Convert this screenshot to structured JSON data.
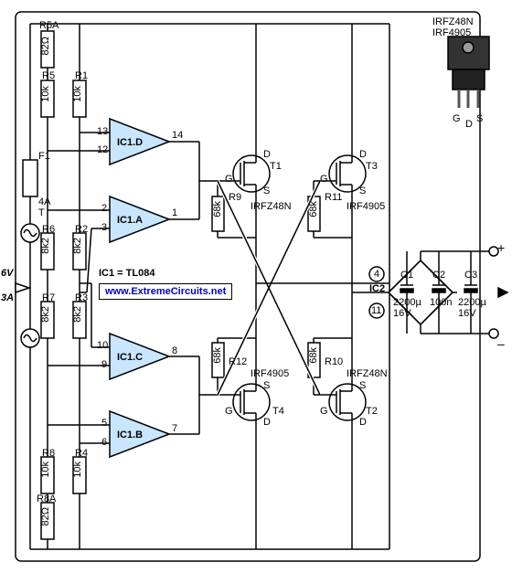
{
  "mosfets_list": "IRFZ48N\nIRF4905",
  "package_pins": {
    "g": "G",
    "d": "D",
    "s": "S"
  },
  "ic_note": "IC1  = TL084",
  "url": "www.ExtremeCircuits.net",
  "supply": {
    "v": "6V",
    "a": "3A"
  },
  "fuse": {
    "ref": "F1",
    "val": "4A\nT"
  },
  "resistors": {
    "R5A": {
      "ref": "R5A",
      "val": "82Ω"
    },
    "R5": {
      "ref": "R5",
      "val": "10k"
    },
    "R1": {
      "ref": "R1",
      "val": "10k"
    },
    "R6": {
      "ref": "R6",
      "val": "8k2"
    },
    "R2": {
      "ref": "R2",
      "val": "8k2"
    },
    "R7": {
      "ref": "R7",
      "val": "8k2"
    },
    "R3": {
      "ref": "R3",
      "val": "8k2"
    },
    "R8": {
      "ref": "R8",
      "val": "10k"
    },
    "R4": {
      "ref": "R4",
      "val": "10k"
    },
    "R8A": {
      "ref": "R8A",
      "val": "82Ω"
    },
    "R9": {
      "ref": "R9",
      "val": "68k"
    },
    "R11": {
      "ref": "R11",
      "val": "68k"
    },
    "R12": {
      "ref": "R12",
      "val": "68k"
    },
    "R10": {
      "ref": "R10",
      "val": "68k"
    }
  },
  "opamps": {
    "D": {
      "ref": "IC1.D",
      "in1": "13",
      "in2": "12",
      "out": "14"
    },
    "A": {
      "ref": "IC1.A",
      "in1": "2",
      "in2": "3",
      "out": "1"
    },
    "C": {
      "ref": "IC1.C",
      "in1": "10",
      "in2": "9",
      "out": "8"
    },
    "B": {
      "ref": "IC1.B",
      "in1": "5",
      "in2": "6",
      "out": "7"
    }
  },
  "ic2": {
    "ref": "IC2",
    "p4": "4",
    "p11": "11"
  },
  "trans": {
    "T1": {
      "ref": "T1",
      "type": "IRFZ48N",
      "g": "G",
      "d": "D",
      "s": "S"
    },
    "T3": {
      "ref": "T3",
      "type": "IRF4905",
      "g": "G",
      "d": "D",
      "s": "S"
    },
    "T4": {
      "ref": "T4",
      "type": "IRF4905",
      "g": "G",
      "d": "D",
      "s": "S"
    },
    "T2": {
      "ref": "T2",
      "type": "IRFZ48N",
      "g": "G",
      "d": "D",
      "s": "S"
    }
  },
  "caps": {
    "C1": {
      "ref": "C1",
      "val": "2200µ\n16V"
    },
    "C2": {
      "ref": "C2",
      "val": "100n"
    },
    "C3": {
      "ref": "C3",
      "val": "2200µ\n16V"
    }
  },
  "polarity": {
    "plus": "+",
    "minus": "–"
  }
}
